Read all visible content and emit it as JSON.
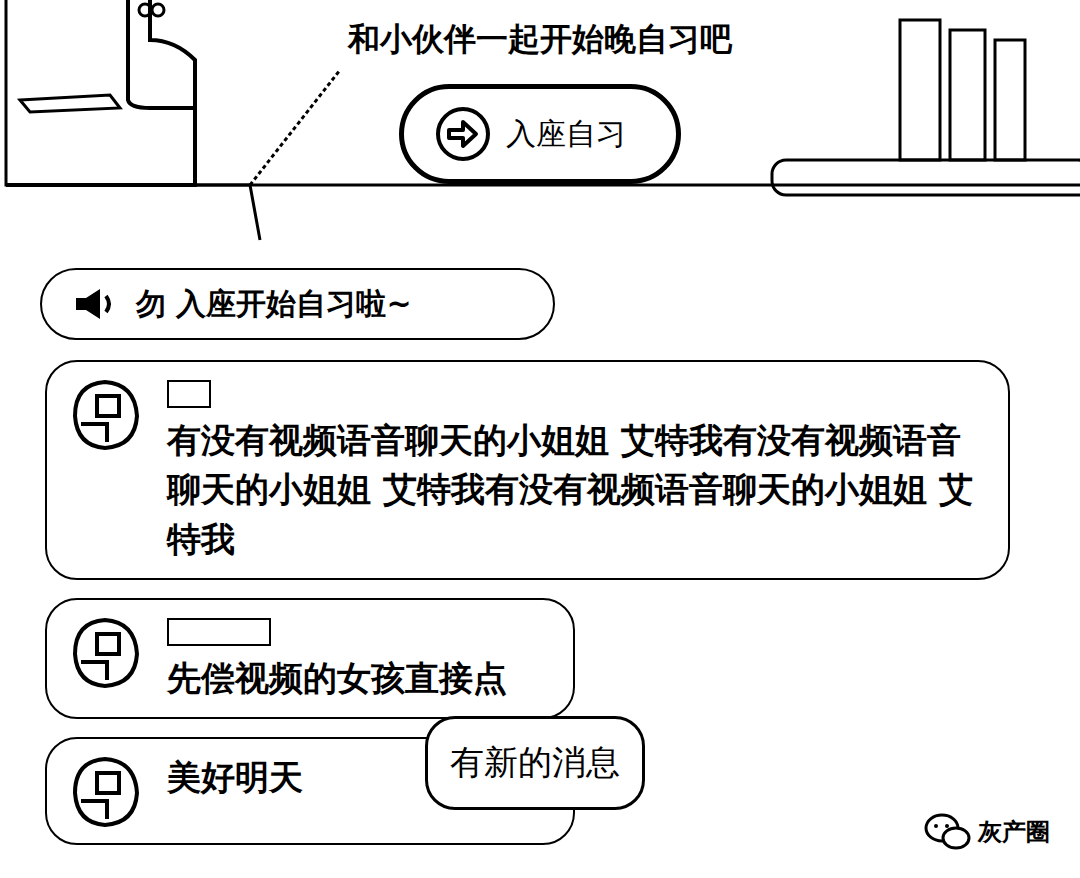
{
  "header": {
    "title": "和小伙伴一起开始晚自习吧",
    "button": "入座自习"
  },
  "notice": {
    "text": "勿 入座开始自习啦~"
  },
  "messages": [
    {
      "text": "有没有视频语音聊天的小姐姐 艾特我有没有视频语音聊天的小姐姐 艾特我有没有视频语音聊天的小姐姐 艾特我"
    },
    {
      "text": "先偿视频的女孩直接点"
    },
    {
      "text": "美好明天"
    }
  ],
  "toast": "有新的消息",
  "watermark": "灰产圈"
}
